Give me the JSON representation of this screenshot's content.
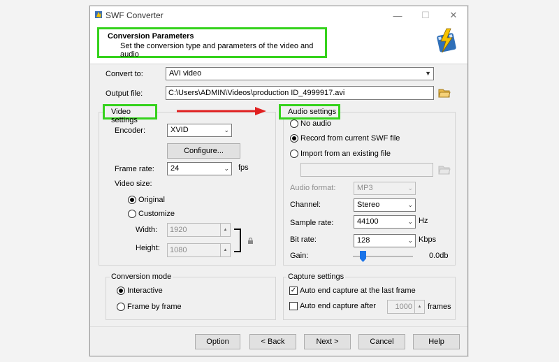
{
  "window": {
    "title": "SWF Converter",
    "minimize": "—",
    "maximize": "☐",
    "close": "✕"
  },
  "header": {
    "title": "Conversion Parameters",
    "subtitle": "Set the conversion type and parameters of the video and audio"
  },
  "convert_to": {
    "label": "Convert to:",
    "value": "AVI video"
  },
  "output_file": {
    "label": "Output file:",
    "value": "C:\\Users\\ADMIN\\Videos\\production ID_4999917.avi"
  },
  "video": {
    "group_label": "Video settings",
    "encoder_label": "Encoder:",
    "encoder_value": "XVID",
    "configure_label": "Configure...",
    "frame_rate_label": "Frame rate:",
    "frame_rate_value": "24",
    "fps_label": "fps",
    "video_size_label": "Video size:",
    "original_label": "Original",
    "customize_label": "Customize",
    "width_label": "Width:",
    "width_value": "1920",
    "height_label": "Height:",
    "height_value": "1080"
  },
  "audio": {
    "group_label": "Audio settings",
    "no_audio_label": "No audio",
    "record_label": "Record from current SWF file",
    "import_label": "Import from an existing file",
    "file_value": "",
    "format_label": "Audio format:",
    "format_value": "MP3",
    "channel_label": "Channel:",
    "channel_value": "Stereo",
    "sample_rate_label": "Sample rate:",
    "sample_rate_value": "44100",
    "hz_label": "Hz",
    "bit_rate_label": "Bit rate:",
    "bit_rate_value": "128",
    "kbps_label": "Kbps",
    "gain_label": "Gain:",
    "gain_value": "0.0db"
  },
  "conversion_mode": {
    "group_label": "Conversion mode",
    "interactive_label": "Interactive",
    "frame_label": "Frame by frame"
  },
  "capture": {
    "group_label": "Capture settings",
    "auto_end_last_label": "Auto end capture at the last frame",
    "auto_end_after_label": "Auto end capture after",
    "frames_value": "1000",
    "frames_label": "frames"
  },
  "buttons": {
    "option": "Option",
    "back": "< Back",
    "next": "Next >",
    "cancel": "Cancel",
    "help": "Help"
  },
  "colors": {
    "annotation_green": "#35d21c",
    "annotation_red": "#e02020"
  }
}
